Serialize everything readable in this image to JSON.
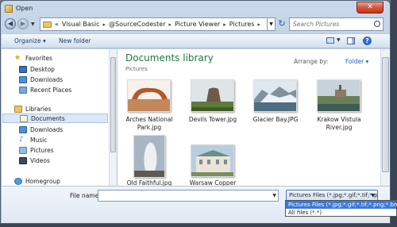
{
  "window": {
    "title": "Open",
    "close_label": "✕"
  },
  "address": {
    "overflow": "«",
    "crumbs": [
      "Visual Basic",
      "@SourceCodester",
      "Picture Viewer",
      "Pictures"
    ],
    "search_placeholder": "Search Pictures"
  },
  "toolbar": {
    "organize": "Organize ▾",
    "new_folder": "New folder",
    "help": "?"
  },
  "nav": {
    "favorites": "Favorites",
    "desktop": "Desktop",
    "downloads": "Downloads",
    "recent": "Recent Places",
    "libraries": "Libraries",
    "documents": "Documents",
    "lib_downloads": "Downloads",
    "music": "Music",
    "pictures": "Pictures",
    "videos": "Videos",
    "homegroup": "Homegroup"
  },
  "content": {
    "title": "Documents library",
    "subtitle": "Pictures",
    "arrange_label": "Arrange by:",
    "arrange_value": "Folder ▾",
    "files": [
      {
        "name": "Arches National Park.jpg"
      },
      {
        "name": "Devils Tower.jpg"
      },
      {
        "name": "Glacier Bay.JPG"
      },
      {
        "name": "Krakow Vistula River.jpg"
      },
      {
        "name": "Old Faithful.jpg"
      },
      {
        "name": "Warsaw Copper"
      }
    ]
  },
  "bottom": {
    "file_name_label": "File name:",
    "file_name_value": "",
    "filter_selected": "Pictures Files (*.jpg;*.gif;*.tif;*.p",
    "filter_options": [
      "Pictures Files (*.jpg;*.gif;*.tif;*.png;*.bmp)",
      "All files (*.*)"
    ]
  }
}
